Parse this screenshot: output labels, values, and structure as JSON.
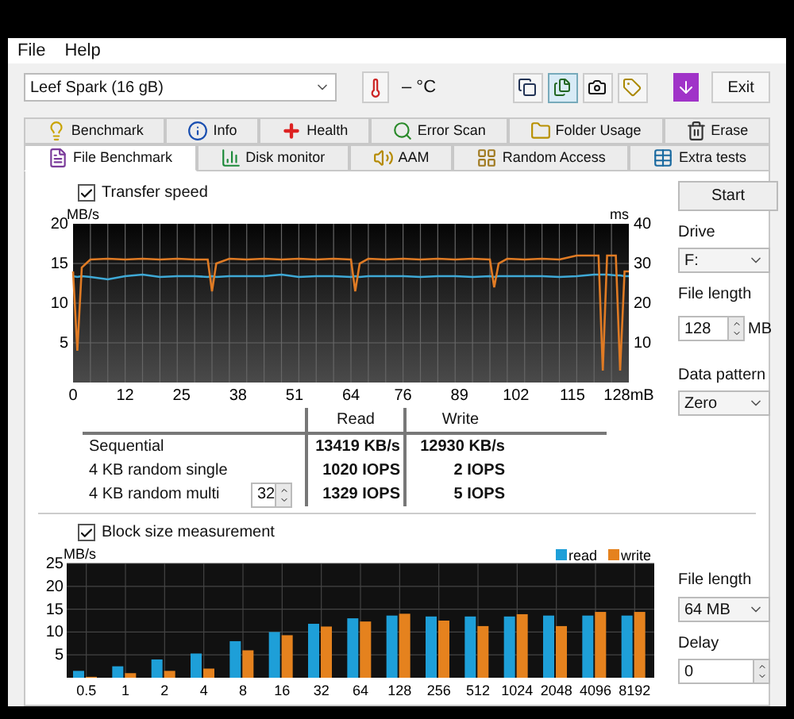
{
  "menu": [
    "File",
    "Help"
  ],
  "toolbar": {
    "drive": "Leef   Spark (16 gB)",
    "temperature": "– °C",
    "exit": "Exit"
  },
  "tabs_back": [
    {
      "label": "Benchmark",
      "selected": false
    },
    {
      "label": "Info",
      "selected": false
    },
    {
      "label": "Health",
      "selected": false
    },
    {
      "label": "Error Scan",
      "selected": false
    },
    {
      "label": "Folder Usage",
      "selected": false
    },
    {
      "label": "Erase",
      "selected": false
    }
  ],
  "tabs_front": [
    {
      "label": "File Benchmark",
      "selected": true
    },
    {
      "label": "Disk monitor",
      "selected": false
    },
    {
      "label": "AAM",
      "selected": false
    },
    {
      "label": "Random Access",
      "selected": false
    },
    {
      "label": "Extra tests",
      "selected": false
    }
  ],
  "transfer": {
    "label": "Transfer speed",
    "checked": true,
    "right_axis": {
      "label": "ms",
      "ticks": [
        "40",
        "30",
        "20",
        "10"
      ]
    },
    "chart_data": {
      "type": "line",
      "grid": true,
      "ylabel": "MB/s",
      "xlim": [
        0,
        128
      ],
      "ylim": [
        0,
        20
      ],
      "xticks": [
        0,
        12,
        25,
        38,
        51,
        64,
        76,
        89,
        102,
        115,
        {
          "value": 128,
          "label": "128mB"
        }
      ],
      "yticks": [
        5,
        10,
        15,
        20
      ],
      "x": [
        0,
        1,
        2,
        4,
        8,
        12,
        16,
        20,
        24,
        28,
        31,
        32,
        33,
        36,
        40,
        44,
        48,
        52,
        56,
        60,
        64,
        65,
        66,
        68,
        72,
        76,
        80,
        84,
        88,
        92,
        96,
        97,
        98,
        100,
        104,
        108,
        112,
        116,
        120,
        121,
        122,
        123,
        125,
        126,
        127,
        128
      ],
      "series": [
        {
          "color": "#3fa9d6",
          "values": [
            13.4,
            13.3,
            13.4,
            13.3,
            13.0,
            13.4,
            13.6,
            13.3,
            13.4,
            13.4,
            13.3,
            13.4,
            13.3,
            13.4,
            13.4,
            13.4,
            13.6,
            13.3,
            13.4,
            13.4,
            13.3,
            13.4,
            13.3,
            13.4,
            13.4,
            13.4,
            13.3,
            13.4,
            13.4,
            13.3,
            13.4,
            13.3,
            13.4,
            13.4,
            13.4,
            13.4,
            13.3,
            13.4,
            13.6,
            13.6,
            13.6,
            13.6,
            13.5,
            13.5,
            13.4,
            13.4
          ]
        },
        {
          "color": "#e07b24",
          "values": [
            14,
            4,
            14.5,
            15.5,
            15.6,
            15.5,
            15.6,
            15.5,
            15.6,
            15.5,
            15.5,
            11.5,
            15,
            15.6,
            15.5,
            15.6,
            15.5,
            15.6,
            15.5,
            15.6,
            15.5,
            11.5,
            15,
            15.6,
            15.5,
            15.6,
            15.5,
            15.6,
            15.5,
            15.6,
            15.5,
            12,
            15,
            15.6,
            15.5,
            15.6,
            15.5,
            16,
            16,
            16,
            1.5,
            16,
            16,
            1.5,
            14,
            14
          ]
        }
      ]
    }
  },
  "results": {
    "columns": [
      "Read",
      "Write"
    ],
    "rows": [
      {
        "label": "Sequential",
        "read": "13419 KB/s",
        "write": "12930 KB/s"
      },
      {
        "label": "4 KB random single",
        "read": "1020 IOPS",
        "write": "2 IOPS"
      },
      {
        "label": "4 KB random multi",
        "queue": "32",
        "read": "1329 IOPS",
        "write": "5 IOPS"
      }
    ]
  },
  "block": {
    "label": "Block size measurement",
    "checked": true,
    "chart_data": {
      "type": "bar",
      "grid": true,
      "legend": true,
      "ylabel": "MB/s",
      "ylim": [
        0,
        25
      ],
      "yticks": [
        5,
        10,
        15,
        20,
        25
      ],
      "categories": [
        "0.5",
        "1",
        "2",
        "4",
        "8",
        "16",
        "32",
        "64",
        "128",
        "256",
        "512",
        "1024",
        "2048",
        "4096",
        "8192"
      ],
      "series": [
        {
          "name": "read",
          "color": "#1e9fd8",
          "values": [
            1.5,
            2.5,
            4,
            5.3,
            8,
            10,
            11.8,
            13,
            13.6,
            13.4,
            13.4,
            13.4,
            13.6,
            13.6,
            13.6
          ]
        },
        {
          "name": "write",
          "color": "#e5821e",
          "values": [
            0.2,
            1,
            1.5,
            2,
            6,
            9.3,
            11.2,
            12.3,
            14,
            12.5,
            11.3,
            13.9,
            11.3,
            14.4,
            14.4
          ]
        }
      ]
    }
  },
  "side": {
    "start": "Start",
    "drive_label": "Drive",
    "drive": "F:",
    "file_length_label": "File length",
    "file_length": "128",
    "unit": "MB",
    "pattern_label": "Data pattern",
    "pattern": "Zero"
  },
  "side_lower": {
    "file_length_label": "File length",
    "file_length": "64 MB",
    "delay_label": "Delay",
    "delay": "0"
  }
}
